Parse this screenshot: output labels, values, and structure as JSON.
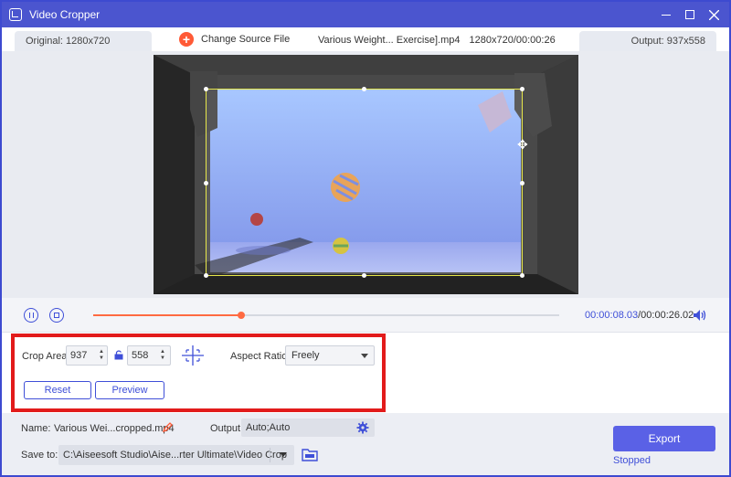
{
  "window": {
    "title": "Video Cropper"
  },
  "info_bar": {
    "original": "Original: 1280x720",
    "change_source": "Change Source File",
    "file_name": "Various Weight... Exercise].mp4",
    "file_meta": "1280x720/00:00:26",
    "output": "Output: 937x558"
  },
  "playback": {
    "current_time": "00:00:08.03",
    "total_time": "/00:00:26.02",
    "progress": 0.317
  },
  "crop": {
    "area_label": "Crop Area:",
    "width": "937",
    "height": "558",
    "ratio_label": "Aspect Ratio:",
    "ratio_value": "Freely",
    "reset_label": "Reset",
    "preview_label": "Preview"
  },
  "output_settings": {
    "name_label": "Name:",
    "name_value": "Various Wei...cropped.mp4",
    "output_label": "Output:",
    "output_value": "Auto;Auto",
    "save_label": "Save to:",
    "save_path": "C:\\Aiseesoft Studio\\Aise...rter Ultimate\\Video Crop",
    "export_label": "Export",
    "status": "Stopped"
  },
  "colors": {
    "accent": "#3f4fd8",
    "title_bar": "#4b55cf",
    "progress": "#ff6a42",
    "highlight_frame": "#e21b1b"
  }
}
